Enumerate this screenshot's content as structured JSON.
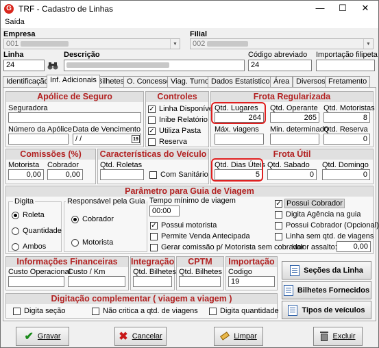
{
  "window": {
    "title": "TRF - Cadastro de Linhas",
    "logo": "G"
  },
  "menu": {
    "saida": "Saída"
  },
  "header": {
    "empresa_label": "Empresa",
    "empresa_code": "001",
    "filial_label": "Filial",
    "filial_code": "002",
    "linha_label": "Linha",
    "linha_value": "24",
    "descricao_label": "Descrição",
    "codigo_abreviado_label": "Código abreviado",
    "codigo_abreviado_value": "24",
    "importacao_label": "Importação filipeta"
  },
  "tabs": [
    "Identificação",
    "Inf. Adicionais",
    "Bilhetes",
    "O. Concessor",
    "Viag. Turno",
    "Dados Estatísticos",
    "Área",
    "Diversos",
    "Fretamento"
  ],
  "apolice": {
    "title": "Apólice de Seguro",
    "seguradora": "Seguradora",
    "numero": "Número da Apólice",
    "vencimento": "Data de Vencimento",
    "vencimento_value": " /  /",
    "cal": "19"
  },
  "controles": {
    "title": "Controles",
    "items": [
      {
        "label": "Linha Disponível",
        "checked": "✓"
      },
      {
        "label": "Inibe Relatório",
        "checked": ""
      },
      {
        "label": "Utiliza Pasta",
        "checked": "✓"
      },
      {
        "label": "Reserva",
        "checked": ""
      }
    ]
  },
  "frota_reg": {
    "title": "Frota Regularizada",
    "qtd_lugares": "Qtd. Lugares",
    "qtd_lugares_v": "264",
    "qtd_operante": "Qtd. Operante",
    "qtd_operante_v": "265",
    "qtd_motoristas": "Qtd. Motoristas",
    "qtd_motoristas_v": "8",
    "max_viagens": "Máx. viagens",
    "min_det": "Min. determinado",
    "qtd_reserva": "Qtd. Reserva",
    "qtd_reserva_v": "0"
  },
  "comissoes": {
    "title": "Comissões (%)",
    "motorista": "Motorista",
    "motorista_v": "0,00",
    "cobrador": "Cobrador",
    "cobrador_v": "0,00"
  },
  "veiculo": {
    "title": "Características do Veículo",
    "roletas": "Qtd. Roletas",
    "sanitario": "Com Sanitário"
  },
  "frota_util": {
    "title": "Frota Útil",
    "dias_uteis": "Qtd. Dias Úteis",
    "dias_uteis_v": "5",
    "sabado": "Qtd. Sabado",
    "sabado_v": "0",
    "domingo": "Qtd. Domingo",
    "domingo_v": "0"
  },
  "parametro": {
    "title": "Parâmetro para Guia de Viagem",
    "digita": "Digita",
    "roleta": "Roleta",
    "quantidade": "Quantidade",
    "ambos": "Ambos",
    "responsavel": "Responsável pela Guia",
    "cobrador": "Cobrador",
    "motorista": "Motorista",
    "tempo_minimo": "Tempo mínimo de viagem",
    "tempo_v": "00:00",
    "possui_motorista": "Possui motorista",
    "permite_venda": "Permite Venda Antecipada",
    "gerar_comissao": "Gerar comissão p/ Motorista sem cobrador",
    "possui_cobrador": "Possui Cobrador",
    "digita_agencia": "Digita Agência na guia",
    "possui_cobrador_opc": "Possui Cobrador (Opcional)",
    "linha_sem": "Linha sem  qtd. de viagens",
    "valor_assalto": "Valor assalto:",
    "valor_assalto_v": "0,00"
  },
  "financeiras": {
    "title": "Informações Financeiras",
    "custo_op": "Custo Operacional",
    "custo_km": "Custo / Km"
  },
  "integracao": {
    "title": "Integração",
    "qtd": "Qtd. Bilhetes"
  },
  "cptm": {
    "title": "CPTM",
    "qtd": "Qtd. Bilhetes"
  },
  "importacao": {
    "title": "Importação",
    "codigo": "Codigo",
    "codigo_v": "19"
  },
  "side_buttons": {
    "secoes": "Seções da Linha",
    "bilhetes": "Bilhetes Fornecidos",
    "tipos": "Tipos de veículos"
  },
  "complementar": {
    "title": "Digitação complementar ( viagem a viagem )",
    "digita_secao": "Digita seção",
    "nao_critica": "Não critica a qtd. de  viagens",
    "digita_qtd": "Digita quantidade"
  },
  "footer": {
    "gravar": "Gravar",
    "cancelar": "Cancelar",
    "limpar": "Limpar",
    "excluir": "Excluir"
  }
}
